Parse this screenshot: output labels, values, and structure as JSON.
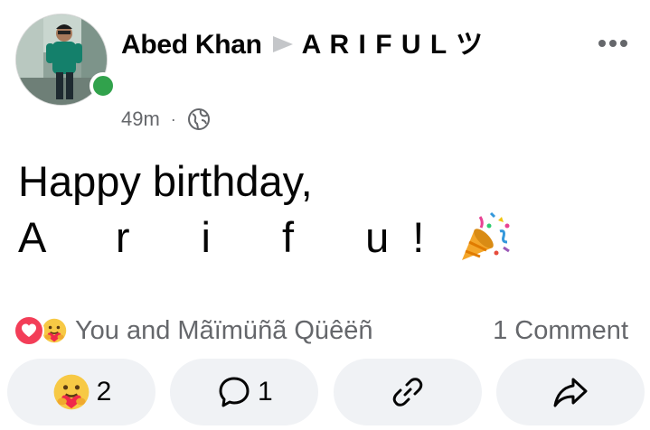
{
  "post": {
    "author_name": "Abed Khan",
    "target_name": "A R I F U L ツ",
    "time": "49m",
    "separator": "·",
    "privacy_icon": "globe-icon",
    "text_line1": "Happy birthday,",
    "text_line2": "A r i f u!",
    "emoji_icon": "party-popper-icon",
    "online_color": "#31a24c"
  },
  "summary": {
    "reactors": "You and Mãïmüñã Qüêëñ",
    "comments": "1 Comment",
    "reaction_icons": [
      "love-icon",
      "care-icon"
    ]
  },
  "actions": {
    "react_count": "2",
    "comment_count": "1",
    "react_icon": "care-icon",
    "comment_icon": "comment-bubble-icon",
    "link_icon": "link-icon",
    "share_icon": "share-icon"
  }
}
